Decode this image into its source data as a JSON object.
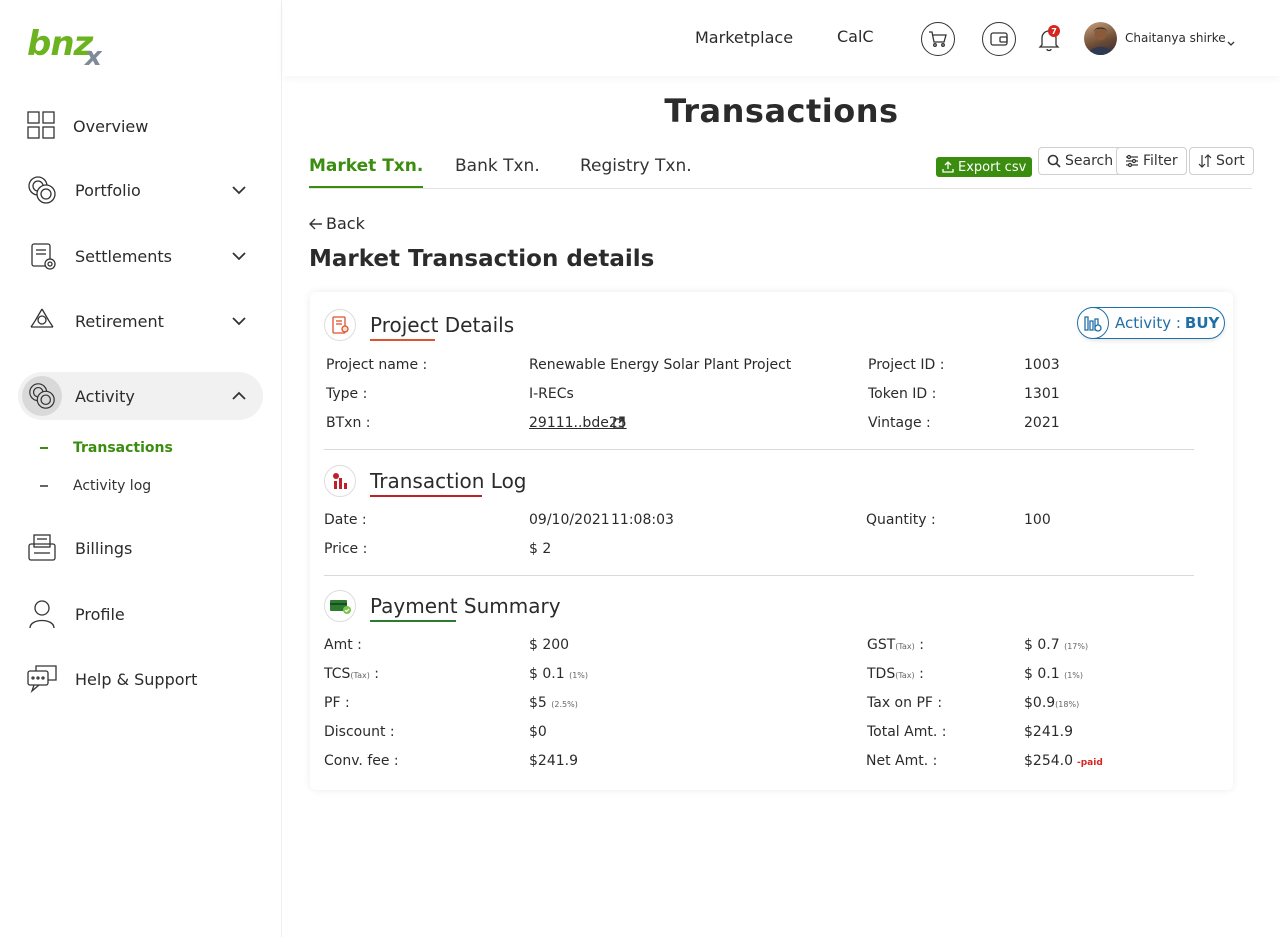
{
  "brand": {
    "logo_text": "bnz",
    "logo_x": "x",
    "accent": "#3a8d0f"
  },
  "sidebar": {
    "items": [
      {
        "label": "Overview",
        "icon": "grid-icon"
      },
      {
        "label": "Portfolio",
        "icon": "coins-icon"
      },
      {
        "label": "Settlements",
        "icon": "settlements-icon"
      },
      {
        "label": "Retirement",
        "icon": "recycle-icon"
      },
      {
        "label": "Activity",
        "icon": "coins-icon"
      },
      {
        "label": "Billings",
        "icon": "printer-icon"
      },
      {
        "label": "Profile",
        "icon": "user-icon"
      },
      {
        "label": "Help & Support",
        "icon": "chat-icon"
      }
    ],
    "sub_items": [
      {
        "label": "Transactions"
      },
      {
        "label": "Activity log"
      }
    ]
  },
  "topbar": {
    "marketplace": "Marketplace",
    "calc": "CalC",
    "notification_count": "7",
    "user_name": "Chaitanya shirke"
  },
  "page": {
    "title": "Transactions",
    "tabs": [
      "Market Txn.",
      "Bank Txn.",
      "Registry Txn."
    ],
    "export": "Export csv",
    "search": "Search",
    "filter": "Filter",
    "sort": "Sort",
    "back": "Back",
    "section_title": "Market Transaction details"
  },
  "card": {
    "activity_label": "Activity :",
    "activity_value": "BUY",
    "project": {
      "title": "Project Details",
      "rows": [
        {
          "l1": "Project name :",
          "v1": "Renewable Energy Solar Plant Project",
          "l2": "Project ID :",
          "v2": "1003"
        },
        {
          "l1": "Type :",
          "v1": "I-RECs",
          "l2": "Token ID :",
          "v2": "1301"
        },
        {
          "l1": "BTxn :",
          "v1": "29111..bde25",
          "l2": "Vintage :",
          "v2": "2021"
        }
      ]
    },
    "txlog": {
      "title": "Transaction Log",
      "date_label": "Date :",
      "date_value": "09/10/2021",
      "time_value": "11:08:03",
      "quantity_label": "Quantity  :",
      "quantity_value": "100",
      "price_label": "Price :",
      "price_value": "$ 2"
    },
    "payment": {
      "title": "Payment Summary",
      "amt_label": "Amt :",
      "amt_value": "$ 200",
      "gst_label": "GST",
      "gst_tax": "(Tax)",
      "gst_value": "$ 0.7",
      "gst_pct": "(17%)",
      "tcs_label": "TCS",
      "tcs_tax": "(Tax)",
      "tcs_value": "$ 0.1",
      "tcs_pct": "(1%)",
      "tds_label": "TDS",
      "tds_tax": "(Tax)",
      "tds_value": "$ 0.1",
      "tds_pct": "(1%)",
      "pf_label": "PF :",
      "pf_value": "$5",
      "pf_pct": "(2.5%)",
      "taxpf_label": "Tax on PF :",
      "taxpf_value": "$0.9",
      "taxpf_pct": "(18%)",
      "discount_label": "Discount :",
      "discount_value": "$0",
      "total_label": "Total Amt. :",
      "total_value": "$241.9",
      "conv_label": "Conv. fee :",
      "conv_value": "$241.9",
      "net_label": "Net Amt. :",
      "net_value": "$254.0",
      "net_status": "-paid"
    }
  }
}
